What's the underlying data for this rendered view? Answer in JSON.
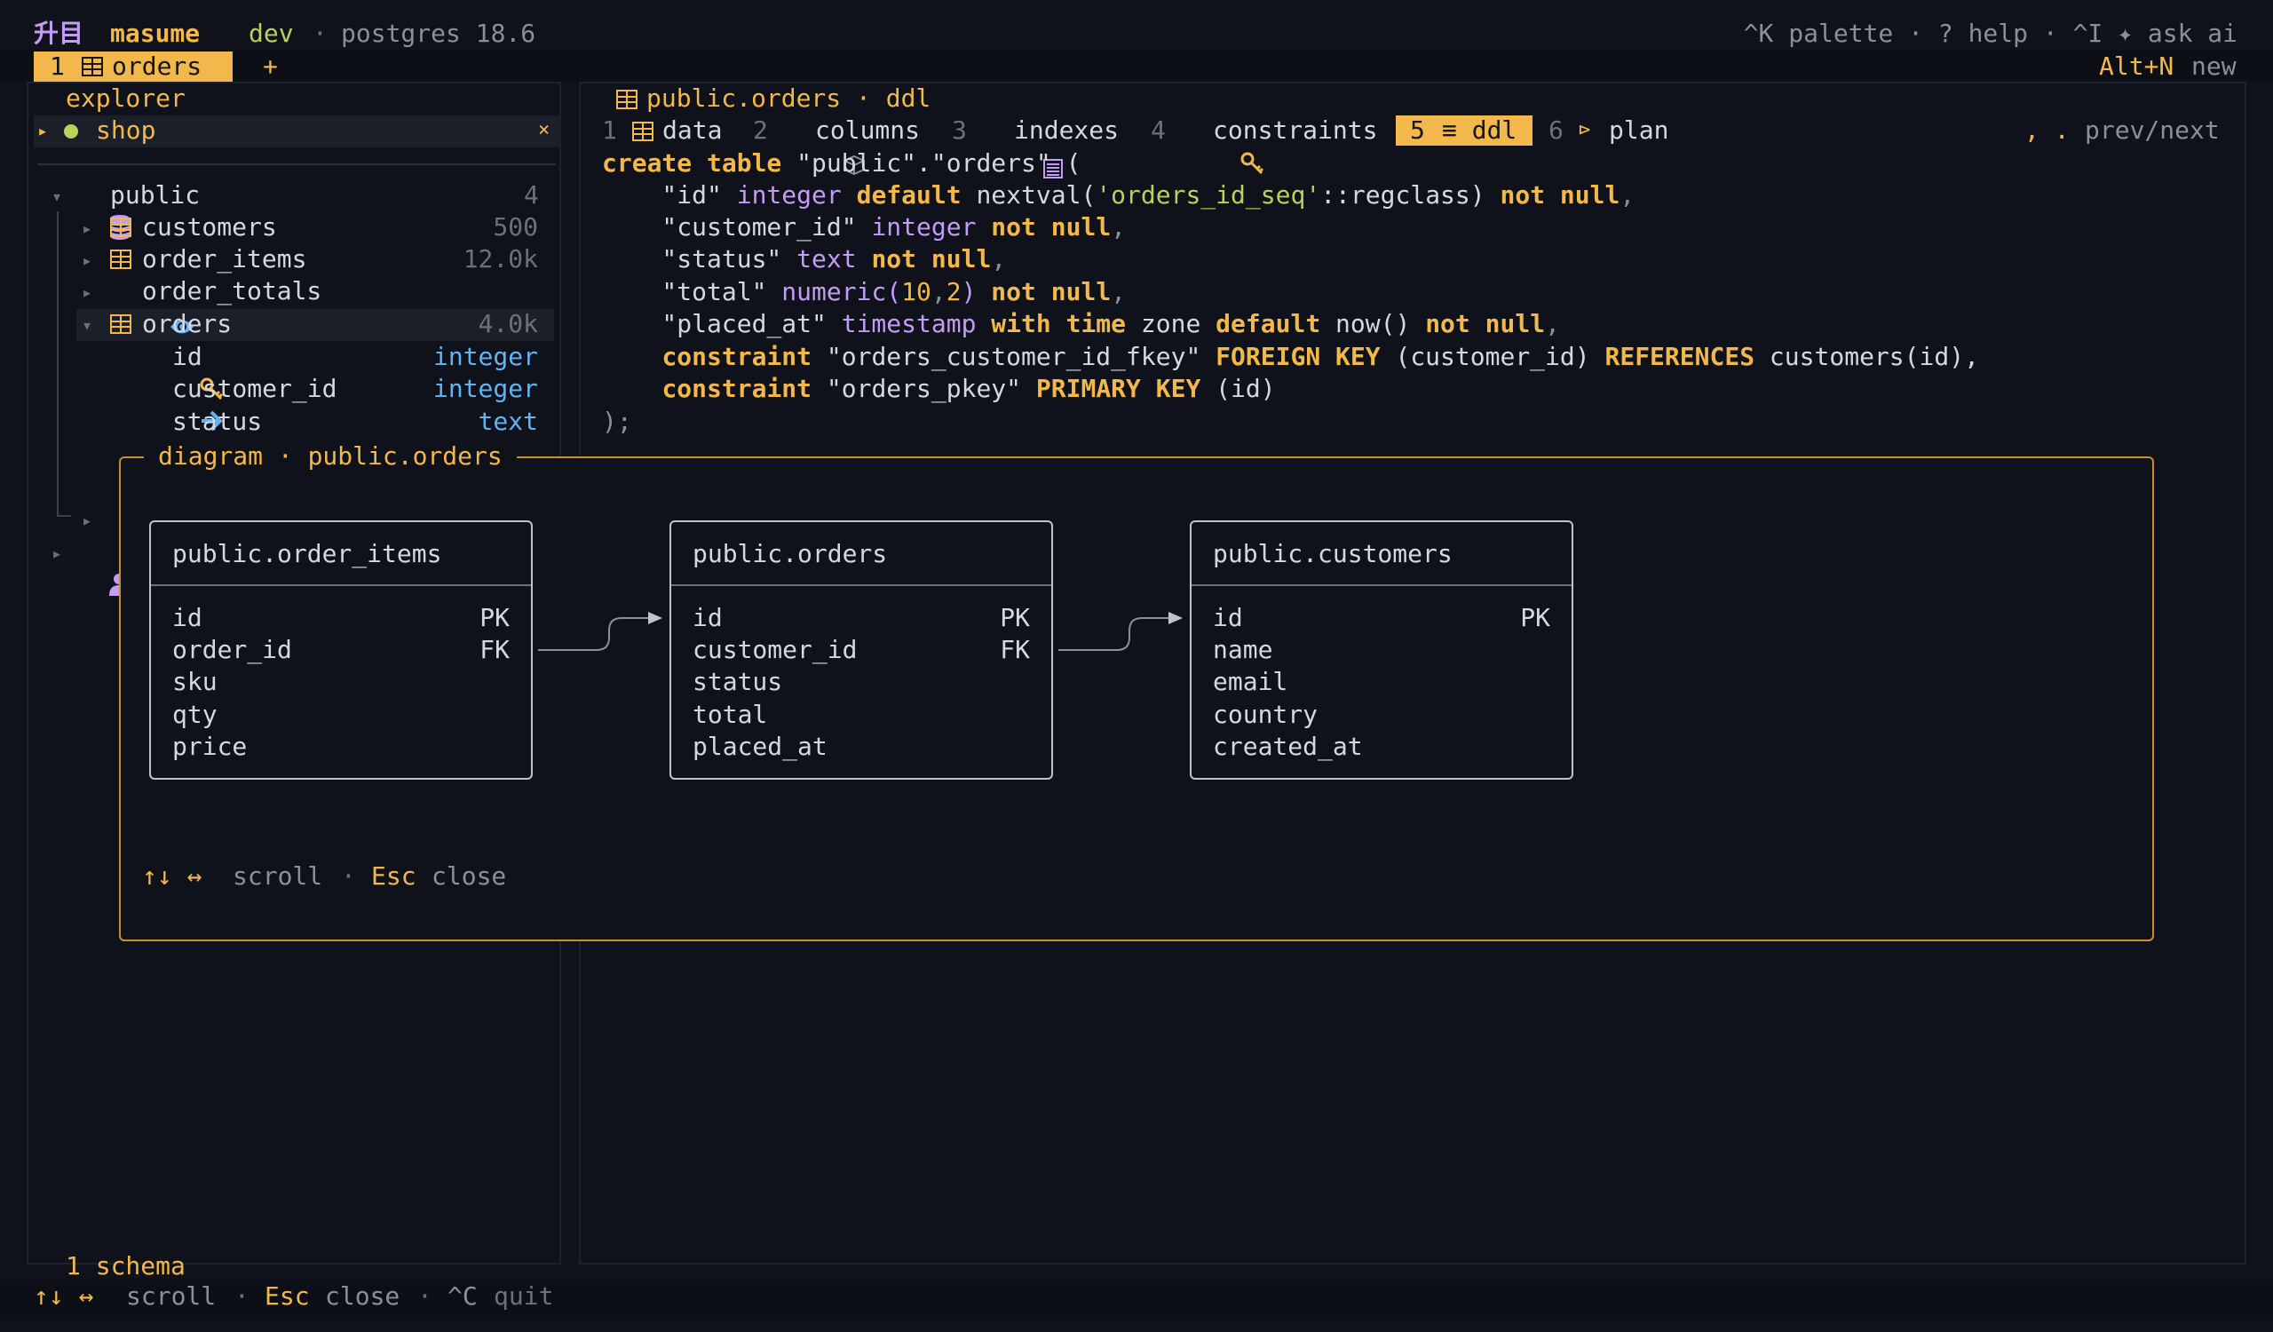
{
  "titlebar": {
    "logo": "升目",
    "app_name": "masume",
    "env": "dev",
    "sep": "·",
    "db": "postgres 18.6",
    "shortcuts": "^K palette · ? help · ^I ✦ ask ai"
  },
  "tabbar": {
    "tabs": [
      {
        "index": "1",
        "label": "orders"
      }
    ],
    "add": "+",
    "new_key": "Alt+N",
    "new_label": "new"
  },
  "explorer": {
    "title": "explorer",
    "connection": {
      "arrow": "▸",
      "name": "shop",
      "close": "×"
    },
    "schema": {
      "arrow": "▾",
      "name": "public",
      "count": "4"
    },
    "tables": [
      {
        "arrow": "▸",
        "name": "customers",
        "count": "500",
        "kind": "table"
      },
      {
        "arrow": "▸",
        "name": "order_items",
        "count": "12.0k",
        "kind": "table"
      },
      {
        "arrow": "▸",
        "name": "order_totals",
        "count": "",
        "kind": "view"
      },
      {
        "arrow": "▾",
        "name": "orders",
        "count": "4.0k",
        "kind": "table"
      }
    ],
    "columns": [
      {
        "name": "id",
        "type": "integer",
        "icon": "key-icon"
      },
      {
        "name": "customer_id",
        "type": "integer",
        "icon": "arrow-right-icon"
      },
      {
        "name": "status",
        "type": "text",
        "icon": "cube-icon"
      }
    ],
    "hidden_arrow": "▸",
    "role_arrow": "▸",
    "footer": "1 schema"
  },
  "editor": {
    "breadcrumb": "public.orders · ddl",
    "tabs": [
      {
        "num": "1",
        "label": "data"
      },
      {
        "num": "2",
        "label": "columns"
      },
      {
        "num": "3",
        "label": "indexes"
      },
      {
        "num": "4",
        "label": "constraints"
      },
      {
        "num": "5",
        "label": "≡ ddl"
      },
      {
        "num": "6",
        "label": "plan"
      }
    ],
    "plan_icon": "⊳",
    "prevnext_keys": ", .",
    "prevnext_label": "prev/next"
  },
  "ddl": {
    "l1": {
      "a": "create table",
      "b": " \"public\".\"orders\" ("
    },
    "l2": {
      "a": "    \"id\" ",
      "b": "integer",
      "c": " default",
      "d": " nextval(",
      "e": "'orders_id_seq'",
      "f": "::regclass) ",
      "g": "not null",
      "h": ","
    },
    "l3": {
      "a": "    \"customer_id\" ",
      "b": "integer",
      "c": " not null",
      "d": ","
    },
    "l4": {
      "a": "    \"status\" ",
      "b": "text",
      "c": " not null",
      "d": ","
    },
    "l5": {
      "a": "    \"total\" ",
      "b": "numeric(",
      "c": "10",
      "d": ",",
      "e": "2",
      "f": ")",
      "g": " not null",
      "h": ","
    },
    "l6": {
      "a": "    \"placed_at\" ",
      "b": "timestamp",
      "c": " with time",
      "d": " zone ",
      "e": "default",
      "f": " now() ",
      "g": "not null",
      "h": ","
    },
    "l7": {
      "a": "    ",
      "b": "constraint",
      "c": " \"orders_customer_id_fkey\" ",
      "d": "FOREIGN KEY",
      "e": " (customer_id) ",
      "f": "REFERENCES",
      "g": " customers(id),"
    },
    "l8": {
      "a": "    ",
      "b": "constraint",
      "c": " \"orders_pkey\" ",
      "d": "PRIMARY KEY",
      "e": " (id)"
    },
    "l9": ");"
  },
  "diagram": {
    "title": "diagram · public.orders",
    "tables": [
      {
        "name": "public.order_items",
        "fields": [
          {
            "name": "id",
            "key": "PK"
          },
          {
            "name": "order_id",
            "key": "FK"
          },
          {
            "name": "sku",
            "key": ""
          },
          {
            "name": "qty",
            "key": ""
          },
          {
            "name": "price",
            "key": ""
          }
        ]
      },
      {
        "name": "public.orders",
        "fields": [
          {
            "name": "id",
            "key": "PK"
          },
          {
            "name": "customer_id",
            "key": "FK"
          },
          {
            "name": "status",
            "key": ""
          },
          {
            "name": "total",
            "key": ""
          },
          {
            "name": "placed_at",
            "key": ""
          }
        ]
      },
      {
        "name": "public.customers",
        "fields": [
          {
            "name": "id",
            "key": "PK"
          },
          {
            "name": "name",
            "key": ""
          },
          {
            "name": "email",
            "key": ""
          },
          {
            "name": "country",
            "key": ""
          },
          {
            "name": "created_at",
            "key": ""
          }
        ]
      }
    ],
    "hint_keys": "↑↓ ↔",
    "hint_scroll": "scroll",
    "hint_sep": "·",
    "hint_esc": "Esc",
    "hint_close": "close"
  },
  "statusbar": {
    "keys": "↑↓ ↔",
    "scroll": "scroll",
    "sep": "·",
    "esc": "Esc",
    "close": "close",
    "sep2": "·",
    "quit_key": "^C",
    "quit": "quit"
  },
  "colors": {
    "accent": "#f2b84b",
    "green": "#b7d35a",
    "purple": "#c59cf5",
    "blue": "#62b3f2",
    "background": "#0f121a"
  }
}
